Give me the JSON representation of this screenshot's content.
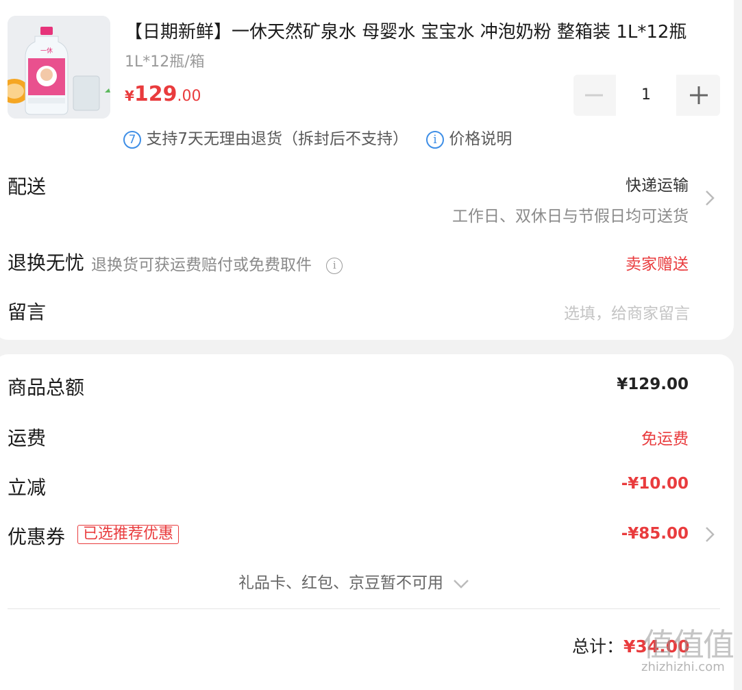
{
  "product": {
    "title": "【日期新鲜】一休天然矿泉水 母婴水 宝宝水 冲泡奶粉 整箱装 1L*12瓶",
    "spec": "1L*12瓶/箱",
    "price_symbol": "¥",
    "price_int": "129",
    "price_dec": ".00",
    "quantity": "1",
    "bottle_logo": "一休",
    "return_badge": "7",
    "return_policy": "支持7天无理由退货（拆封后不支持）",
    "price_info_label": "价格说明"
  },
  "delivery": {
    "label": "配送",
    "method": "快递运输",
    "note": "工作日、双休日与节假日均可送货"
  },
  "return_worry": {
    "label": "退换无忧",
    "desc": "退换货可获运费赔付或免费取件",
    "value": "卖家赠送"
  },
  "message": {
    "label": "留言",
    "placeholder": "选填，给商家留言"
  },
  "summary": {
    "goods_total_label": "商品总额",
    "goods_total": "¥129.00",
    "shipping_label": "运费",
    "shipping_value": "免运费",
    "discount_label": "立减",
    "discount_value": "-¥10.00",
    "coupon_label": "优惠券",
    "coupon_tag": "已选推荐优惠",
    "coupon_value": "-¥85.00",
    "unavailable_note": "礼品卡、红包、京豆暂不可用",
    "total_label": "总计：",
    "total_value": "¥34.00"
  },
  "watermark": {
    "glyphs": "值值值",
    "site": "zhizhizhi.com"
  },
  "colors": {
    "accent_red": "#e93b3d",
    "info_blue": "#3e8ee6",
    "background": "#f2f2f2"
  },
  "icons": [
    "minus-icon",
    "plus-icon",
    "chevron-right-icon",
    "info-icon",
    "chevron-down-icon",
    "seven-days-icon"
  ]
}
